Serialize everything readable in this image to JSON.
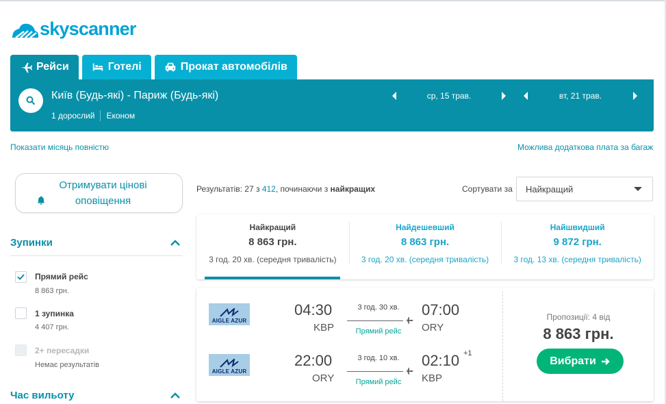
{
  "brand": {
    "name": "skyscanner"
  },
  "tabs": [
    {
      "label": "Рейси",
      "icon": "plane-icon",
      "active": true
    },
    {
      "label": "Готелі",
      "icon": "bed-icon",
      "active": false
    },
    {
      "label": "Прокат автомобілів",
      "icon": "car-icon",
      "active": false
    }
  ],
  "search": {
    "route": "Київ (Будь-які) - Париж (Будь-які)",
    "passengers": "1 дорослий",
    "cabin": "Економ",
    "depart_date": "ср, 15 трав.",
    "return_date": "вт, 21 трав."
  },
  "links": {
    "month": "Показати місяць повністю",
    "baggage": "Можлива додаткова плата за багаж"
  },
  "alerts": {
    "label": "Отримувати цінові оповіщення"
  },
  "filters": {
    "stops": {
      "title": "Зупинки",
      "options": [
        {
          "label": "Прямий рейс",
          "sub": "8 863 грн.",
          "checked": true,
          "disabled": false
        },
        {
          "label": "1 зупинка",
          "sub": "4 407 грн.",
          "checked": false,
          "disabled": false
        },
        {
          "label": "2+ пересадки",
          "sub": "Немає результатів",
          "checked": false,
          "disabled": true
        }
      ]
    },
    "departure": {
      "title": "Час вильоту"
    }
  },
  "results": {
    "prefix": "Результатів: 27 з ",
    "total": "412",
    "middle": ", починаючи з ",
    "bold": "найкращих"
  },
  "sort": {
    "label": "Сортувати за",
    "selected": "Найкращий"
  },
  "sort_cards": [
    {
      "title": "Найкращий",
      "price": "8 863 грн.",
      "duration": "3 год. 20 хв. (середня тривалість)",
      "selected": true
    },
    {
      "title": "Найдешевший",
      "price": "8 863 грн.",
      "duration": "3 год. 20 хв. (середня тривалість)",
      "selected": false
    },
    {
      "title": "Найшвидший",
      "price": "9 872 грн.",
      "duration": "3 год. 13 хв. (середня тривалість)",
      "selected": false
    }
  ],
  "flight": {
    "airline": "AIGLE AZUR",
    "legs": [
      {
        "dep_time": "04:30",
        "dep_airport": "KBP",
        "duration": "3 год. 30 хв.",
        "stops": "Прямий рейс",
        "arr_time": "07:00",
        "arr_airport": "ORY",
        "day_offset": ""
      },
      {
        "dep_time": "22:00",
        "dep_airport": "ORY",
        "duration": "3 год. 10 хв.",
        "stops": "Прямий рейс",
        "arr_time": "02:10",
        "arr_airport": "KBP",
        "day_offset": "+1"
      }
    ],
    "offers": "Пропозиції: 4 від",
    "price": "8 863 грн.",
    "select_label": "Вибрати"
  },
  "colors": {
    "primary": "#0890a8",
    "tab": "#07b0d3",
    "accent_text": "#18a5c9",
    "cta": "#00b577",
    "direct": "#00a698"
  }
}
